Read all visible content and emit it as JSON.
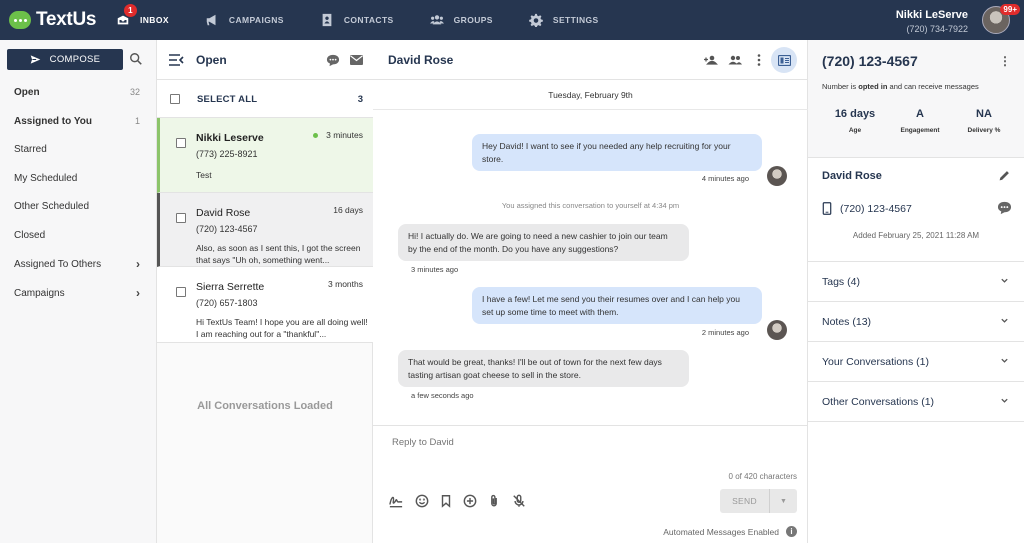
{
  "nav": {
    "logo": "TextUs",
    "inbox_badge": "1",
    "items": [
      {
        "label": "INBOX",
        "icon": "inbox-icon"
      },
      {
        "label": "CAMPAIGNS",
        "icon": "megaphone-icon"
      },
      {
        "label": "CONTACTS",
        "icon": "contacts-icon"
      },
      {
        "label": "GROUPS",
        "icon": "groups-icon"
      },
      {
        "label": "SETTINGS",
        "icon": "gear-icon"
      }
    ],
    "user_name": "Nikki LeServe",
    "user_phone": "(720) 734-7922",
    "avatar_badge": "99+"
  },
  "sidebar": {
    "compose_label": "COMPOSE",
    "items": [
      {
        "label": "Open",
        "count": "32"
      },
      {
        "label": "Assigned to You",
        "count": "1"
      },
      {
        "label": "Starred"
      },
      {
        "label": "My Scheduled"
      },
      {
        "label": "Other Scheduled"
      },
      {
        "label": "Closed"
      },
      {
        "label": "Assigned To Others",
        "chevron": "›"
      },
      {
        "label": "Campaigns",
        "chevron": "›"
      }
    ]
  },
  "convlist": {
    "title": "Open",
    "select_all": "SELECT ALL",
    "count": "3",
    "conversations": [
      {
        "name": "Nikki Leserve",
        "phone": "(773) 225-8921",
        "time": "3 minutes",
        "snippet": "Test"
      },
      {
        "name": "David Rose",
        "phone": "(720) 123-4567",
        "time": "16 days",
        "snippet": "Also, as soon as I sent this, I got the screen that says \"Uh oh, something went..."
      },
      {
        "name": "Sierra Serrette",
        "phone": "(720) 657-1803",
        "time": "3 months",
        "snippet": "Hi TextUs Team! I hope you are all doing well! I am reaching out for a \"thankful\"..."
      }
    ],
    "all_loaded": "All Conversations Loaded"
  },
  "chat": {
    "title": "David Rose",
    "date": "Tuesday, February 9th",
    "messages": [
      {
        "text": "Hey David! I want to see if you needed any help recruiting for your store.",
        "time": "4 minutes ago"
      },
      {
        "text": "Hi! I actually do. We are going to need a new cashier to join our team by the end of the month. Do you have any suggestions?",
        "time": "3 minutes ago"
      },
      {
        "text": "I have a few! Let me send you their resumes over and I can help you set up some time to meet with them.",
        "time": "2 minutes ago"
      },
      {
        "text": "That would be great, thanks! I'll be out of town for the next few days tasting artisan goat cheese to sell in the store.",
        "time": "a few seconds ago"
      }
    ],
    "system_note": "You assigned this conversation to yourself at 4:34 pm",
    "reply_placeholder": "Reply to David",
    "char_count": "0 of 420 characters",
    "send_label": "SEND",
    "automated": "Automated Messages Enabled"
  },
  "contact": {
    "phone": "(720) 123-4567",
    "optin_prefix": "Number is ",
    "optin_bold": "opted in",
    "optin_suffix": " and can receive messages",
    "stats": [
      {
        "value": "16 days",
        "label": "Age"
      },
      {
        "value": "A",
        "label": "Engagement"
      },
      {
        "value": "NA",
        "label": "Delivery %"
      }
    ],
    "name": "David Rose",
    "contact_phone": "(720) 123-4567",
    "added": "Added February 25, 2021 11:28 AM",
    "sections": [
      {
        "label": "Tags",
        "count": "(4)"
      },
      {
        "label": "Notes",
        "count": "(13)"
      },
      {
        "label": "Your Conversations",
        "count": "(1)"
      },
      {
        "label": "Other Conversations",
        "count": "(1)"
      }
    ]
  }
}
